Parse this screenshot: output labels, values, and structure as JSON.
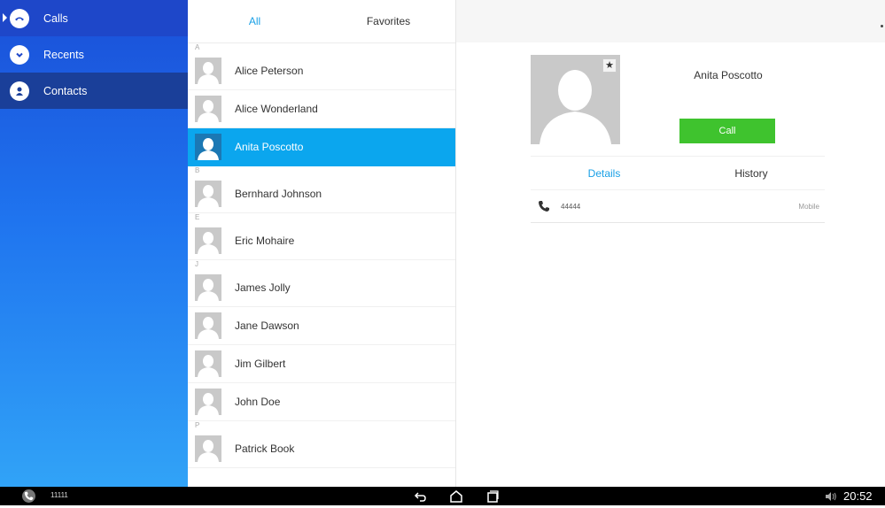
{
  "nav": {
    "items": [
      {
        "label": "Calls",
        "icon": "phone-handset-icon"
      },
      {
        "label": "Recents",
        "icon": "chevron-down-icon"
      },
      {
        "label": "Contacts",
        "icon": "person-icon"
      }
    ]
  },
  "list": {
    "tabs": [
      {
        "label": "All"
      },
      {
        "label": "Favorites"
      }
    ],
    "sections": [
      {
        "letter": "A",
        "contacts": [
          "Alice Peterson",
          "Alice Wonderland",
          "Anita Poscotto"
        ]
      },
      {
        "letter": "B",
        "contacts": [
          "Bernhard Johnson"
        ]
      },
      {
        "letter": "E",
        "contacts": [
          "Eric Mohaire"
        ]
      },
      {
        "letter": "J",
        "contacts": [
          "James Jolly",
          "Jane Dawson",
          "Jim Gilbert",
          "John Doe"
        ]
      },
      {
        "letter": "P",
        "contacts": [
          "Patrick Book"
        ]
      }
    ]
  },
  "detail": {
    "name": "Anita Poscotto",
    "call_label": "Call",
    "tabs": [
      {
        "label": "Details"
      },
      {
        "label": "History"
      }
    ],
    "phone": {
      "number": "44444",
      "type": "Mobile"
    }
  },
  "sysbar": {
    "extension": "11111",
    "time": "20:52"
  },
  "colors": {
    "accent": "#0ba6ee",
    "call_green": "#3fc32e",
    "nav_top": "#1a4fd8",
    "nav_bottom": "#31a3f7"
  }
}
